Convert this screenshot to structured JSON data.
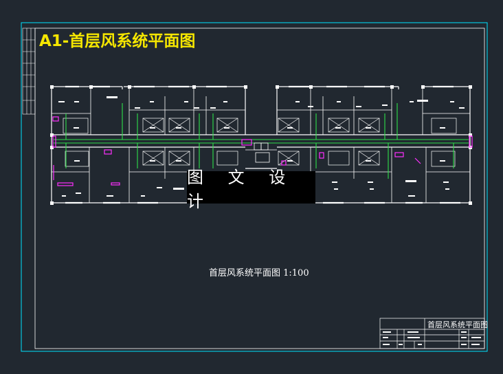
{
  "drawing": {
    "title": "A1-首层风系统平面图",
    "caption": "首层风系统平面图 1:100",
    "watermark": "图 文 设 计",
    "title_block": {
      "name": "首层风系统平面图"
    }
  },
  "colors": {
    "background": "#212830",
    "frame": "#00e5ff",
    "walls": "#ffffff",
    "ducts": "#2fe04a",
    "diffusers": "#ff30ff",
    "title": "#f5e600"
  }
}
